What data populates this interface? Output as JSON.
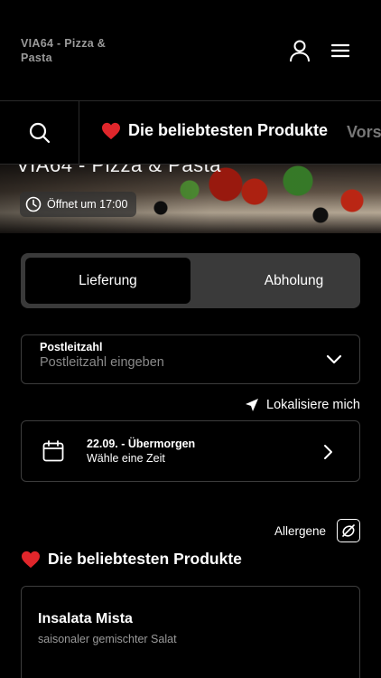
{
  "header": {
    "brand": "VIA64 - Pizza & Pasta",
    "icons": [
      "user-icon",
      "menu-icon"
    ]
  },
  "category_bar": {
    "search_icon": "search-icon",
    "active_category": "Die beliebtesten Produkte",
    "active_emoji": "❤️",
    "next_category": "Vors"
  },
  "hero": {
    "title": "VIA64 - Pizza & Pasta",
    "opening": "Öffnet um 17:00"
  },
  "delivery_toggle": {
    "options": [
      "Lieferung",
      "Abholung"
    ],
    "selected": "Lieferung"
  },
  "postcode": {
    "label": "Postleitzahl",
    "placeholder": "Postleitzahl eingeben"
  },
  "locate": {
    "label": "Lokalisiere mich"
  },
  "date_picker": {
    "date": "22.09. - Übermorgen",
    "hint": "Wähle eine Zeit"
  },
  "allergene": {
    "label": "Allergene"
  },
  "section": {
    "emoji": "❤️",
    "title": "Die beliebtesten Produkte"
  },
  "products": [
    {
      "name": "Insalata Mista",
      "description": "saisonaler gemischter Salat"
    }
  ],
  "colors": {
    "background": "#000000",
    "heart": "#e0262b",
    "toggle_bg": "#3a3a3a",
    "border": "#3d3d3d",
    "muted": "#8a8a8a"
  }
}
